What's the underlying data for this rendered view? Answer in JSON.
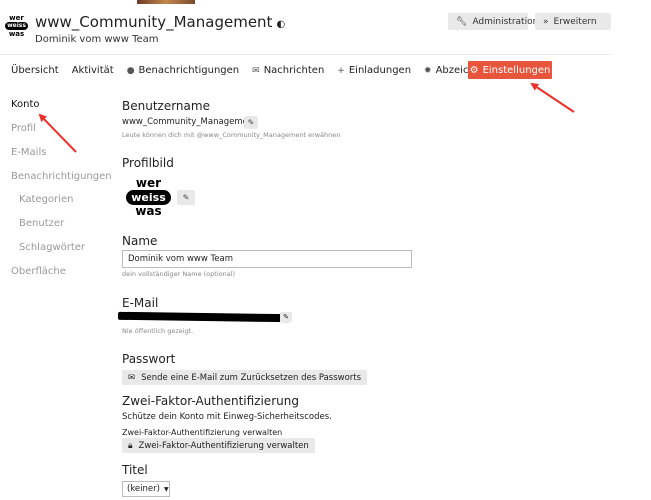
{
  "header": {
    "logo": {
      "line1": "wer",
      "line2": "weiss",
      "line3": "was"
    },
    "title": "www_Community_Management",
    "shield_icon": "◐",
    "subtitle": "Dominik vom www Team",
    "admin_button": "Administration",
    "extend_button": "Erweitern"
  },
  "nav": {
    "items": [
      {
        "label": "Übersicht",
        "icon": ""
      },
      {
        "label": "Aktivität",
        "icon": ""
      },
      {
        "label": "Benachrichtigungen",
        "icon": "speech-bubble"
      },
      {
        "label": "Nachrichten",
        "icon": "envelope"
      },
      {
        "label": "Einladungen",
        "icon": "user-plus"
      },
      {
        "label": "Abzeichen",
        "icon": "certificate"
      }
    ],
    "active": {
      "label": "Einstellungen",
      "icon": "gear"
    }
  },
  "sidebar": {
    "items": [
      {
        "label": "Konto",
        "active": true
      },
      {
        "label": "Profil"
      },
      {
        "label": "E-Mails"
      },
      {
        "label": "Benachrichtigungen"
      },
      {
        "label": "Kategorien"
      },
      {
        "label": "Benutzer"
      },
      {
        "label": "Schlagwörter"
      },
      {
        "label": "Oberfläche"
      }
    ]
  },
  "account": {
    "username_heading": "Benutzername",
    "username_value": "www_Community_Management",
    "username_hint": "Leute können dich mit @www_Community_Management erwähnen",
    "avatar_heading": "Profilbild",
    "avatar": {
      "line1": "wer",
      "line2": "weiss",
      "line3": "was"
    },
    "name_heading": "Name",
    "name_value": "Dominik vom www Team",
    "name_hint": "dein vollständiger Name (optional)",
    "email_heading": "E-Mail",
    "email_hint": "Nie öffentlich gezeigt.",
    "password_heading": "Passwort",
    "password_button": "Sende eine E-Mail zum Zurücksetzen des Passworts",
    "twofa_heading": "Zwei-Faktor-Authentifizierung",
    "twofa_desc": "Schütze dein Konto mit Einweg-Sicherheitscodes.",
    "twofa_manage_label": "Zwei-Faktor-Authentifizierung verwalten",
    "twofa_button": "Zwei-Faktor-Authentifizierung verwalten",
    "title_heading": "Titel",
    "title_select": "(keiner)"
  },
  "colors": {
    "accent": "#e8553d",
    "annotation": "#e8322a"
  }
}
